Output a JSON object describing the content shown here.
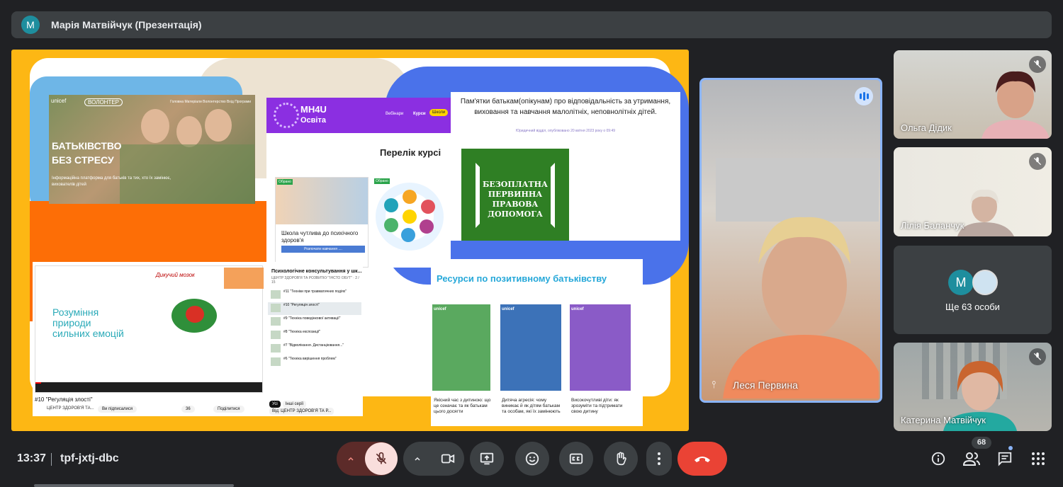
{
  "presenter": {
    "avatar_letter": "М",
    "title": "Марія Матвійчук (Презентація)"
  },
  "slide": {
    "unicef_card": {
      "logo_text": "unicef",
      "volunteer_label": "ВОЛОНТЕР",
      "nav_text": "Головна   Матеріали   Волонтерство   Вхід   Програми",
      "title_line1": "БАТЬКІВСТВО",
      "title_line2": "БЕЗ СТРЕСУ",
      "description": "Інформаційна платформа для батьків та тих, хто їх замінює, вихователів дітей"
    },
    "mh4u_card": {
      "brand_line1": "MH4U",
      "brand_line2": "Освіта",
      "nav_webinars": "Вебінари",
      "nav_courses": "Курси",
      "nav_schools": "Школи",
      "courses_heading": "Перелік курсі",
      "badge_label": "Обрано",
      "course1_title": "Школа чутлива до психічного здоров'я",
      "course1_button": "Розпочати навчання ....",
      "wheel_text": "planet · care · body · be active · mind · give · people · connect"
    },
    "doc_card": {
      "title": "Пам'ятки батькам(опікунам) про відповідальність за утримання, виховання та навчання малолітніх, неповнолітніх дітей.",
      "meta": "Юридичний відділ, опубліковано 20 квітня 2023 року о 09:49",
      "green_text": "БЕЗОПЛАТНА ПЕРВИННА ПРАВОВА ДОПОМОГА"
    },
    "video_card": {
      "video_text": "Розуміння природи сильних емоцій",
      "board_title": "Дикучий мозок",
      "video_title": "#10 \"Регуляція злості\"",
      "channel": "ЦЕНТР ЗДОРОВ'Я ТА...",
      "subscribed": "Ви підписалися",
      "likes": "36",
      "share": "Поділитися",
      "playlist_title": "Психологічне консультування у шк...",
      "playlist_sub": "ЦЕНТР ЗДОРОВ'Я ТА РОЗВИТКУ \"ІНСТО ОБУТ\" · 2 / 15",
      "playlist_items": [
        "#11 \"Техніки при травматичних подіях\"",
        "#10 \"Регуляція злості\"",
        "#9 \"Техніка поведінкової активації\"",
        "#8 \"Техніка експозиції\"",
        "#7 \"Відволікання. Дистанціювання...\"",
        "#6 \"Техніка вирішення проблем\""
      ],
      "chips": [
        "Усі",
        "Інші серії",
        "Від: ЦЕНТР ЗДОРОВ'Я ТА Р..."
      ]
    },
    "resources_card": {
      "title": "Ресурси по позитивному батьківству",
      "items": [
        {
          "caption": "Якісний час з дитиною: що це означає та як батькам цього досягти",
          "color": "#5aa95f"
        },
        {
          "caption": "Дитяча агресія: чому виникає й як дітям батькам та особам, які їх замінюють",
          "color": "#3c72b8"
        },
        {
          "caption": "Високочутливі діти: як зрозуміти та підтримати свою дитину",
          "color": "#8a5bc7"
        }
      ]
    }
  },
  "participants": {
    "speaker": {
      "name": "Леся Первина"
    },
    "olga": {
      "name": "Ольга Дідик"
    },
    "lilia": {
      "name": "Лілія Баланчук"
    },
    "more": {
      "avatar_letter": "М",
      "label": "Ще 63 особи"
    },
    "kateryna": {
      "name": "Катерина Матвійчук"
    }
  },
  "bottom_bar": {
    "time": "13:37",
    "meeting_code": "tpf-jxtj-dbc",
    "participants_count": "68"
  },
  "colors": {
    "accent_blue": "#8ab4f8",
    "end_call_red": "#ea4335",
    "mic_off_bg": "#f9dedc"
  }
}
